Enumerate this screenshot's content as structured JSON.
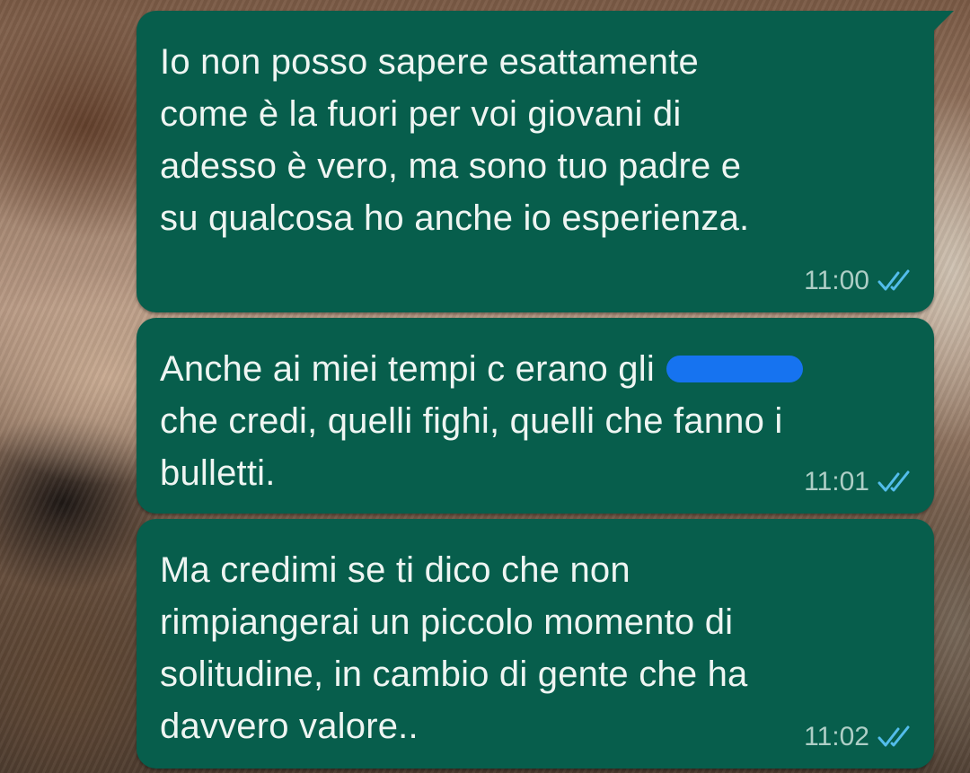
{
  "chat": {
    "messages": [
      {
        "text": "Io non posso sapere esattamente\ncome è la fuori per voi giovani di\nadesso è vero, ma sono tuo padre e\nsu qualcosa ho anche io esperienza.",
        "time": "11:00",
        "status": "read",
        "status_icon": "double-check-icon"
      },
      {
        "text_before_redaction": "Anche ai miei tempi c erano gli ",
        "text_after_redaction": "che credi, quelli fighi, quelli che fanno i\nbulletti.",
        "redaction": "redacted-word",
        "time": "11:01",
        "status": "read",
        "status_icon": "double-check-icon"
      },
      {
        "text": "Ma credimi se ti dico che non\nrimpiangerai un piccolo momento di\nsolitudine, in cambio di gente che ha\ndavvero valore..",
        "time": "11:02",
        "status": "read",
        "status_icon": "double-check-icon"
      }
    ]
  },
  "colors": {
    "bubble": "#075e4c",
    "text": "#eef5f2",
    "timestamp": "#aecec6",
    "read_ticks": "#53bdeb",
    "redaction": "#1673f0"
  }
}
